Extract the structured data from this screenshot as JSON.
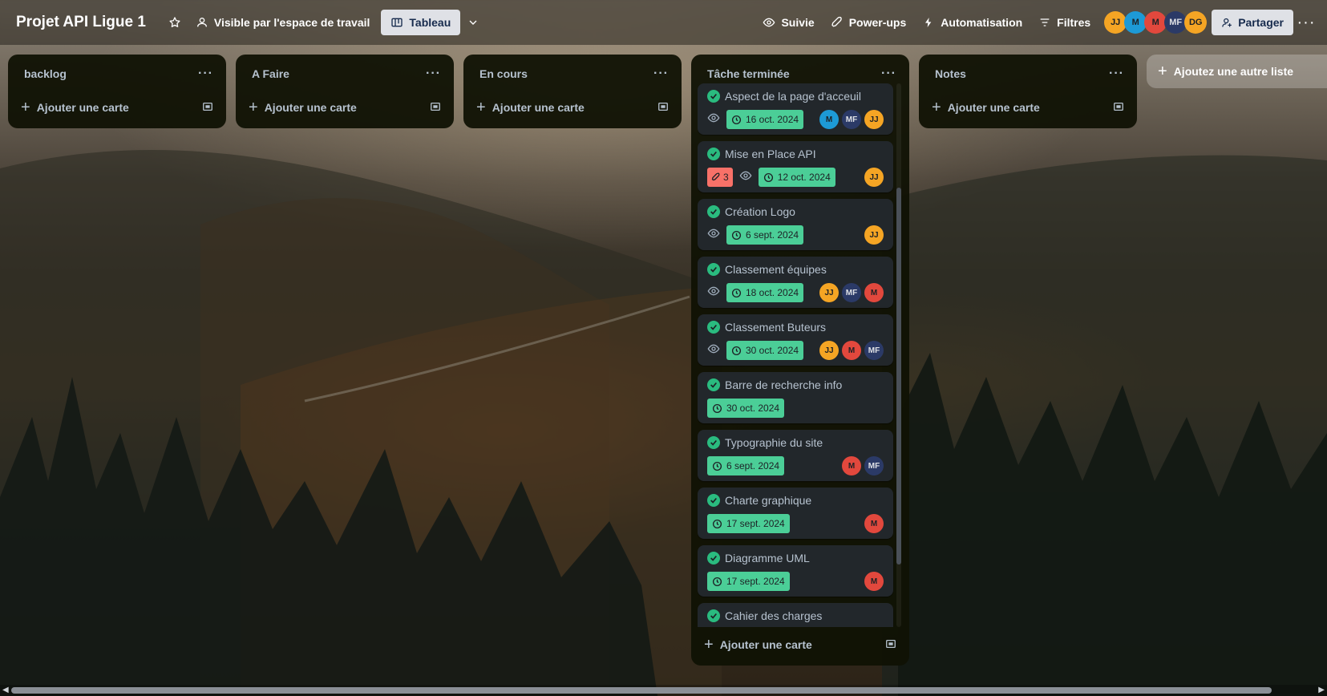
{
  "board": {
    "title": "Projet API Ligue 1",
    "visibility": "Visible par l'espace de travail",
    "view": "Tableau"
  },
  "header": {
    "suivie": "Suivie",
    "powerups": "Power-ups",
    "automation": "Automatisation",
    "filters": "Filtres",
    "share": "Partager",
    "members": [
      {
        "initials": "JJ",
        "color": "#f5a524"
      },
      {
        "initials": "M",
        "color": "#1d9ad6"
      },
      {
        "initials": "M",
        "color": "#e2483d"
      },
      {
        "initials": "MF",
        "color": "#2b3a67"
      },
      {
        "initials": "DG",
        "color": "#f5a524"
      }
    ]
  },
  "lists": {
    "backlog": {
      "title": "backlog",
      "add": "Ajouter une carte"
    },
    "afaire": {
      "title": "A Faire",
      "add": "Ajouter une carte"
    },
    "encours": {
      "title": "En cours",
      "add": "Ajouter une carte"
    },
    "done": {
      "title": "Tâche terminée",
      "add": "Ajouter une carte"
    },
    "notes": {
      "title": "Notes",
      "add": "Ajouter une carte"
    }
  },
  "add_list": "Ajoutez une autre liste",
  "done_cards": [
    {
      "title": "Aspect de la page d'acceuil",
      "due": "16 oct. 2024",
      "watch": true,
      "votes": "",
      "members": [
        "M",
        "MF",
        "JJ"
      ]
    },
    {
      "title": "Mise en Place API",
      "due": "12 oct. 2024",
      "watch": true,
      "votes": "3",
      "members": [
        "JJ"
      ]
    },
    {
      "title": "Création Logo",
      "due": "6 sept. 2024",
      "watch": true,
      "votes": "",
      "members": [
        "JJ"
      ]
    },
    {
      "title": "Classement équipes",
      "due": "18 oct. 2024",
      "watch": true,
      "votes": "",
      "members": [
        "JJ",
        "MF",
        "M"
      ]
    },
    {
      "title": "Classement Buteurs",
      "due": "30 oct. 2024",
      "watch": true,
      "votes": "",
      "members": [
        "JJ",
        "M",
        "MF"
      ]
    },
    {
      "title": "Barre de recherche info",
      "due": "30 oct. 2024",
      "watch": false,
      "votes": "",
      "members": []
    },
    {
      "title": "Typographie du site",
      "due": "6 sept. 2024",
      "watch": false,
      "votes": "",
      "members": [
        "M",
        "MF"
      ]
    },
    {
      "title": "Charte graphique",
      "due": "17 sept. 2024",
      "watch": false,
      "votes": "",
      "members": [
        "M"
      ]
    },
    {
      "title": "Diagramme UML",
      "due": "17 sept. 2024",
      "watch": false,
      "votes": "",
      "members": [
        "M"
      ]
    },
    {
      "title": "Cahier des charges",
      "due": "",
      "watch": false,
      "votes": "",
      "members": []
    }
  ],
  "member_colors": {
    "JJ": "#f5a524",
    "M": "#e2483d",
    "MF": "#2b3a67",
    "DG": "#f5a524",
    "M_alt": "#1d9ad6"
  },
  "colors": {
    "due_complete": "#4bce97",
    "card_bg": "#22272b",
    "list_bg": "#101204",
    "vote_bg": "#f87168"
  }
}
